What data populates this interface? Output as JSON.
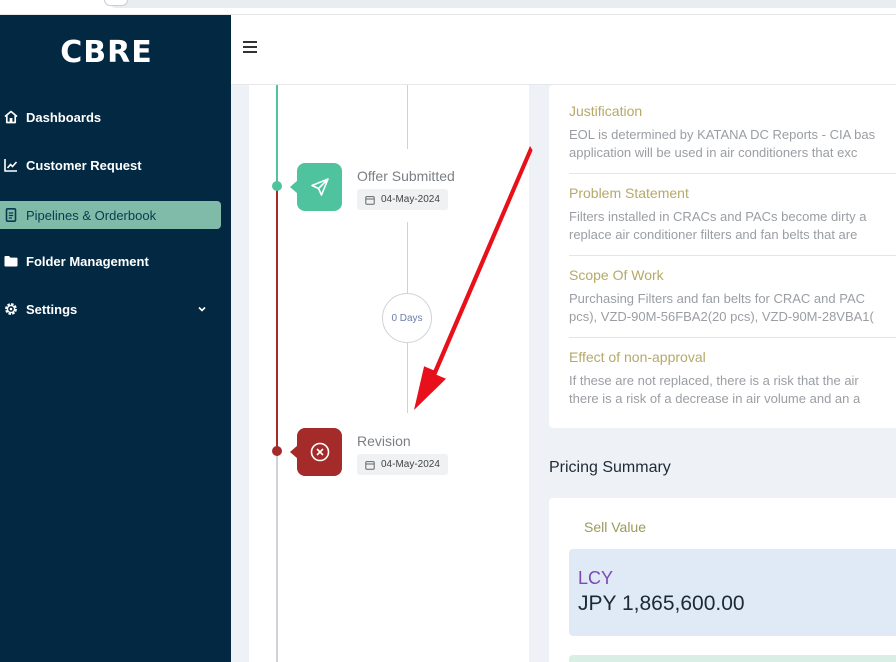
{
  "brand": {
    "logo_text": "CBRE",
    "sidebar_bg": "#032842",
    "active_bg": "#80bba9"
  },
  "sidebar": {
    "items": [
      {
        "label": "Dashboards",
        "icon": "home-icon"
      },
      {
        "label": "Customer Request",
        "icon": "chart-line-icon"
      },
      {
        "label": "Pipelines & Orderbook",
        "icon": "document-icon",
        "active": true
      },
      {
        "label": "Folder Management",
        "icon": "folder-icon"
      },
      {
        "label": "Settings",
        "icon": "gear-icon",
        "has_submenu": true
      }
    ]
  },
  "header": {
    "menu_icon": "hamburger-icon"
  },
  "timeline": {
    "stages": [
      {
        "title": "Offer Submitted",
        "date": "04-May-2024",
        "icon": "send-icon",
        "color": "#4fc39d"
      },
      {
        "title": "Revision",
        "date": "04-May-2024",
        "icon": "close-circle-icon",
        "color": "#a52a2a"
      }
    ],
    "gap_label": "0 Days"
  },
  "details": {
    "sections": [
      {
        "title": "Justification",
        "lines": [
          "EOL is determined by KATANA DC Reports - CIA bas",
          "application will be used in air conditioners that exc"
        ]
      },
      {
        "title": "Problem Statement",
        "lines": [
          "Filters installed in CRACs and PACs become dirty a",
          "replace air conditioner filters and fan belts that are"
        ]
      },
      {
        "title": "Scope Of Work",
        "lines": [
          "Purchasing Filters and fan belts for CRAC and PAC",
          "pcs), VZD-90M-56FBA2(20 pcs), VZD-90M-28VBA1("
        ]
      },
      {
        "title": "Effect of non-approval",
        "lines": [
          "If these are not replaced, there is a risk that the air",
          "there is a risk of a decrease in air volume and an a"
        ]
      }
    ]
  },
  "pricing": {
    "title": "Pricing Summary",
    "sell_value_label": "Sell Value",
    "lcy_label": "LCY",
    "lcy_value": "JPY 1,865,600.00"
  },
  "annotation": {
    "arrow_color": "#e8101a"
  }
}
